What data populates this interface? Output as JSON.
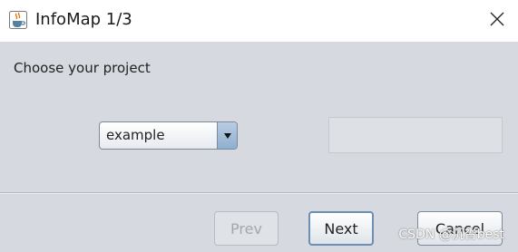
{
  "window": {
    "title": "InfoMap 1/3",
    "app_icon": "java-cup-icon",
    "close_icon": "close-icon"
  },
  "content": {
    "prompt": "Choose your project",
    "project_select": {
      "selected": "example",
      "arrow_icon": "triangle-down-icon"
    },
    "text_field": {
      "value": "",
      "placeholder": ""
    }
  },
  "buttons": {
    "prev": "Prev",
    "next": "Next",
    "cancel": "Cancel"
  },
  "watermark": "CSDN @沉沓best",
  "colors": {
    "background": "#d6d9df",
    "titlebar": "#ffffff",
    "focus_border": "#6d8fb3"
  }
}
